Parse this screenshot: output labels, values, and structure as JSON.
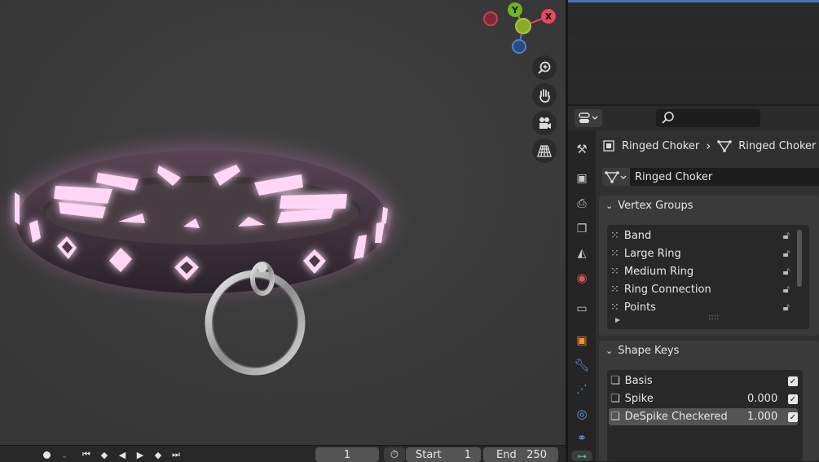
{
  "viewport": {
    "gizmo": {
      "x_label": "X",
      "y_label": "Y"
    },
    "nav_icons": [
      "zoom-icon",
      "pan-hand-icon",
      "camera-icon",
      "grid-icon"
    ]
  },
  "timeline": {
    "current_frame": "1",
    "start_label": "Start",
    "start_value": "1",
    "end_label": "End",
    "end_value": "250"
  },
  "properties": {
    "breadcrumb": {
      "object": "Ringed Choker",
      "separator": "›",
      "mesh": "Ringed Choker"
    },
    "mesh_datablock": "Ringed Choker",
    "vertex_groups": {
      "title": "Vertex Groups",
      "items": [
        "Band",
        "Large Ring",
        "Medium Ring",
        "Ring Connection",
        "Points"
      ],
      "resize_handle": "::::"
    },
    "shape_keys": {
      "title": "Shape Keys",
      "items": [
        {
          "name": "Basis",
          "value": "",
          "checked": true
        },
        {
          "name": "Spike",
          "value": "0.000",
          "checked": true
        },
        {
          "name": "DeSpike Checkered",
          "value": "1.000",
          "checked": true,
          "selected": true
        }
      ]
    },
    "tabs": [
      "tool-icon",
      "render-icon",
      "output-icon",
      "view-layer-icon",
      "scene-icon",
      "world-icon",
      "collection-icon",
      "object-icon",
      "modifier-icon",
      "particles-icon",
      "physics-icon",
      "constraints-icon",
      "data-icon"
    ]
  },
  "colors": {
    "accent_blue": "#4772b3",
    "glow_pink": "#ff8cf0",
    "viewport_bg": "#3c3c3c"
  }
}
